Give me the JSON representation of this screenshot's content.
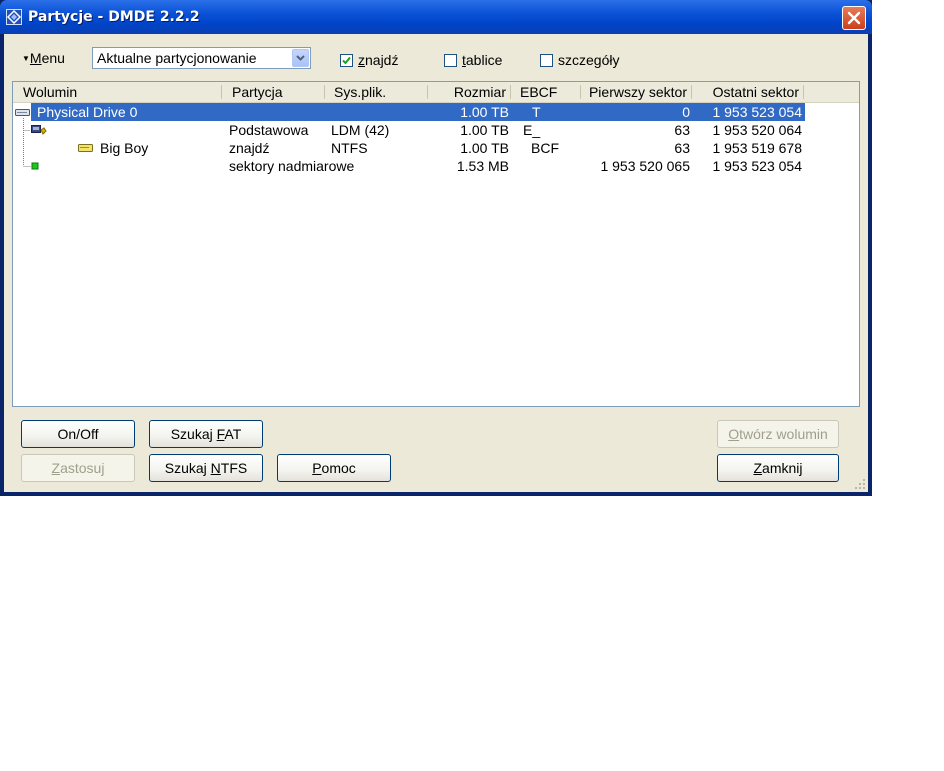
{
  "window": {
    "title": "Partycje - DMDE 2.2.2",
    "colors": {
      "titlebar": "#0a52d6",
      "selection": "#316ac5",
      "face": "#ece9d8",
      "close": "#c9411b"
    }
  },
  "toolbar": {
    "menu_label_pre": "",
    "menu_label_ul": "M",
    "menu_label_post": "enu",
    "combo_value": "Aktualne partycjonowanie",
    "checkboxes": [
      {
        "label_pre": "",
        "label_ul": "z",
        "label_post": "najdź",
        "checked": true
      },
      {
        "label_pre": "",
        "label_ul": "t",
        "label_post": "ablice",
        "checked": false
      },
      {
        "label_pre": "szcze",
        "label_ul": "g",
        "label_post": "óły",
        "checked": false
      }
    ]
  },
  "table": {
    "columns": [
      "Wolumin",
      "Partycja",
      "Sys.plik.",
      "Rozmiar",
      "EBCF",
      "Pierwszy sektor",
      "Ostatni sektor"
    ],
    "rows": [
      {
        "icon": "hard-drive-icon",
        "volume": "Physical Drive 0",
        "partition": "",
        "fs": "",
        "size": "1.00 TB",
        "ebcf": "T",
        "first": "0",
        "last": "1 953 523 054",
        "selected": true
      },
      {
        "icon": "partition-icon",
        "volume": "",
        "partition": "Podstawowa",
        "fs": "LDM (42)",
        "size": "1.00 TB",
        "ebcf": "E_",
        "first": "63",
        "last": "1 953 520 064",
        "selected": false
      },
      {
        "icon": "volume-icon",
        "volume": "Big Boy",
        "partition": "znajdź",
        "fs": "NTFS",
        "size": "1.00 TB",
        "ebcf": "BCF",
        "first": "63",
        "last": "1 953 519 678",
        "selected": false
      },
      {
        "icon": "free-space-icon",
        "volume": "",
        "partition": "sektory nadmiarowe",
        "fs": "",
        "size": "1.53 MB",
        "ebcf": "",
        "first": "1 953 520 065",
        "last": "1 953 523 054",
        "selected": false
      }
    ]
  },
  "buttons": {
    "onoff": {
      "pre": "On/Off",
      "ul": "",
      "post": ""
    },
    "search_fat": {
      "pre": "Szukaj ",
      "ul": "F",
      "post": "AT"
    },
    "open_volume": {
      "pre": "",
      "ul": "O",
      "post": "twórz wolumin"
    },
    "apply": {
      "pre": "",
      "ul": "Z",
      "post": "astosuj"
    },
    "search_ntfs": {
      "pre": "Szukaj ",
      "ul": "N",
      "post": "TFS"
    },
    "help": {
      "pre": "",
      "ul": "P",
      "post": "omoc"
    },
    "close": {
      "pre": "",
      "ul": "Z",
      "post": "amknij"
    }
  }
}
